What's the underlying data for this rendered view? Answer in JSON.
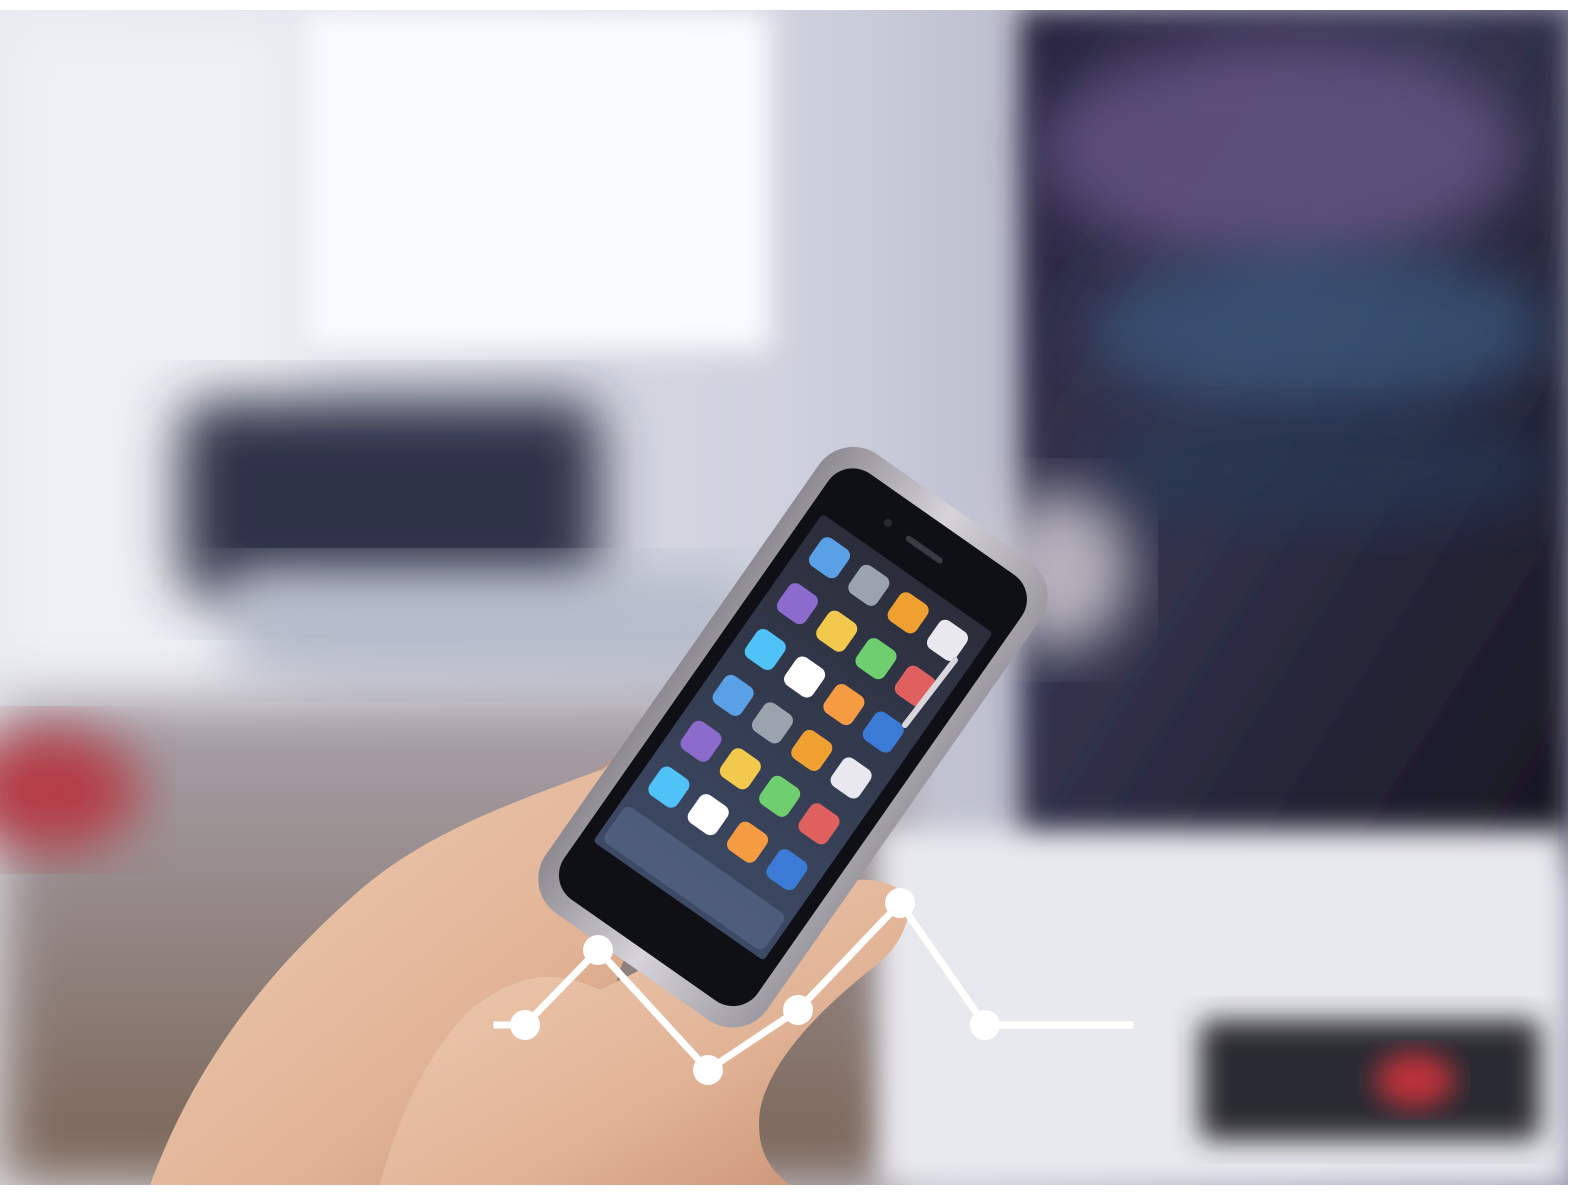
{
  "image": {
    "subject": "hand-holding-smartphone",
    "background": "blurred-living-room-with-tv",
    "colors": {
      "page_bg": "#ffffff",
      "wall": "#c9ccd8",
      "window_light": "#f4f5f9",
      "tv_dark": "#1b1a2c",
      "tv_glow_purple": "#6e5a8f",
      "tv_glow_blue": "#3a4f72",
      "floor": "#8a7464",
      "skin": "#e8c0a4",
      "skin_shadow": "#c8957a",
      "phone_frame": "#b9b6bd",
      "phone_screen": "#1f2028",
      "overlay_line": "#ffffff"
    }
  },
  "overlay_line": {
    "points_count": 6,
    "style": "polyline-with-dots"
  }
}
